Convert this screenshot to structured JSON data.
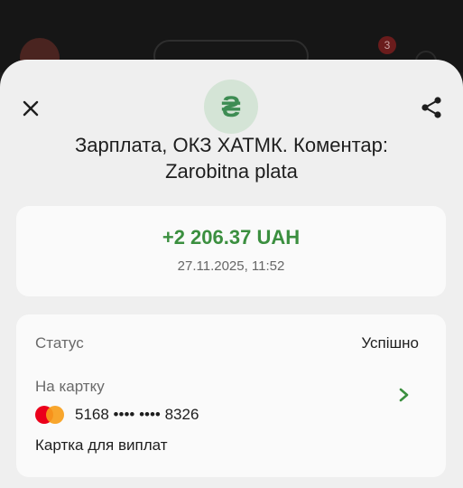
{
  "background": {
    "badge_count": "3"
  },
  "sheet": {
    "title": "Зарплата, ОКЗ ХАТМК. Коментар: Zarobitna plata",
    "currency_icon": "hryvnia-icon",
    "amount": "+2 206.37 UAH",
    "datetime": "27.11.2025, 11:52",
    "status_label": "Статус",
    "status_value": "Успішно",
    "card_label": "На картку",
    "card_number": "5168 •••• •••• 8326",
    "card_name": "Картка для виплат"
  },
  "colors": {
    "accent_green": "#3b8f3f",
    "sheet_bg": "#efefef",
    "card_bg": "#fafafa"
  }
}
